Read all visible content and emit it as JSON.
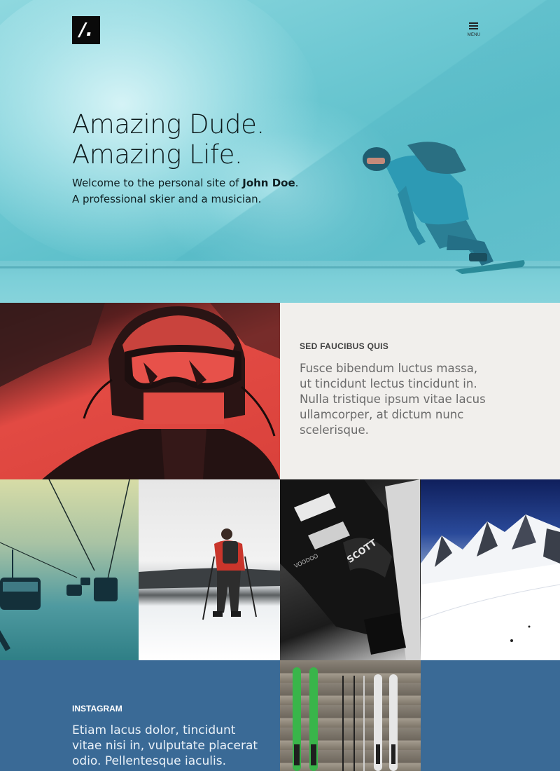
{
  "header": {
    "logo_text": "/.",
    "menu_label": "MENU"
  },
  "hero": {
    "title_line1": "Amazing Dude.",
    "title_line2": "Amazing Life.",
    "sub_prefix": "Welcome to the personal site of ",
    "sub_name": "John Doe",
    "sub_suffix": ".",
    "sub_line2": "A professional skier and a musician."
  },
  "feature": {
    "label": "SED FAUCIBUS QUIS",
    "text": "Fusce bibendum luctus massa, ut tincidunt lectus tincidunt in. Nulla tristique ipsum vitae lacus ullamcorper, at dictum nunc scelerisque."
  },
  "instagram": {
    "label": "INSTAGRAM",
    "text": "Etiam lacus dolor, tincidunt vitae nisi in, vulputate placerat odio. Pellentesque iaculis."
  },
  "colors": {
    "hero_tint": "#6fc9d3",
    "red_tint": "#e24a43",
    "feature_bg": "#f1efec",
    "instagram_bg": "#3a6a96"
  }
}
